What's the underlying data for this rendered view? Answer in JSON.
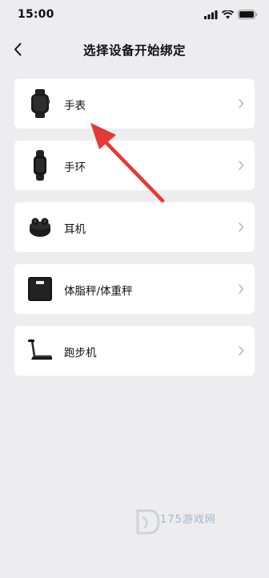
{
  "status_bar": {
    "time": "15:00"
  },
  "nav": {
    "title": "选择设备开始绑定"
  },
  "devices": [
    {
      "label": "手表",
      "icon": "smartwatch-icon"
    },
    {
      "label": "手环",
      "icon": "fitness-band-icon"
    },
    {
      "label": "耳机",
      "icon": "earbuds-icon"
    },
    {
      "label": "体脂秤/体重秤",
      "icon": "scale-icon"
    },
    {
      "label": "跑步机",
      "icon": "treadmill-icon"
    }
  ],
  "annotation": {
    "arrow_color": "#e53935",
    "points_to": "手表"
  },
  "watermark": {
    "text": "175游戏网"
  }
}
